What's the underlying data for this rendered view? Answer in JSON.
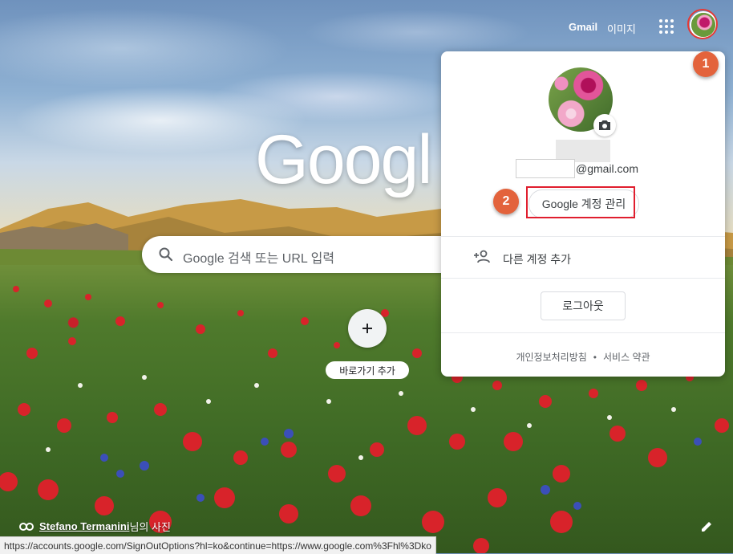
{
  "topbar": {
    "gmail": "Gmail",
    "images": "이미지",
    "apps_icon": "apps-grid-icon"
  },
  "badges": {
    "one": "1",
    "two": "2"
  },
  "logo": {
    "text": "Googl"
  },
  "search": {
    "placeholder": "Google 검색 또는 URL 입력"
  },
  "shortcut": {
    "label": "바로가기 추가"
  },
  "account_panel": {
    "email_suffix": "@gmail.com",
    "manage_label": "Google 계정 관리",
    "add_account_label": "다른 계정 추가",
    "logout_label": "로그아웃",
    "privacy_label": "개인정보처리방침",
    "separator": "•",
    "terms_label": "서비스 약관"
  },
  "credit": {
    "author": "Stefano Termanini",
    "suffix": "님의 사진"
  },
  "status_url": "https://accounts.google.com/SignOutOptions?hl=ko&continue=https://www.google.com%3Fhl%3Dko",
  "colors": {
    "highlight": "#e01e2e",
    "badge": "#e3633c"
  }
}
